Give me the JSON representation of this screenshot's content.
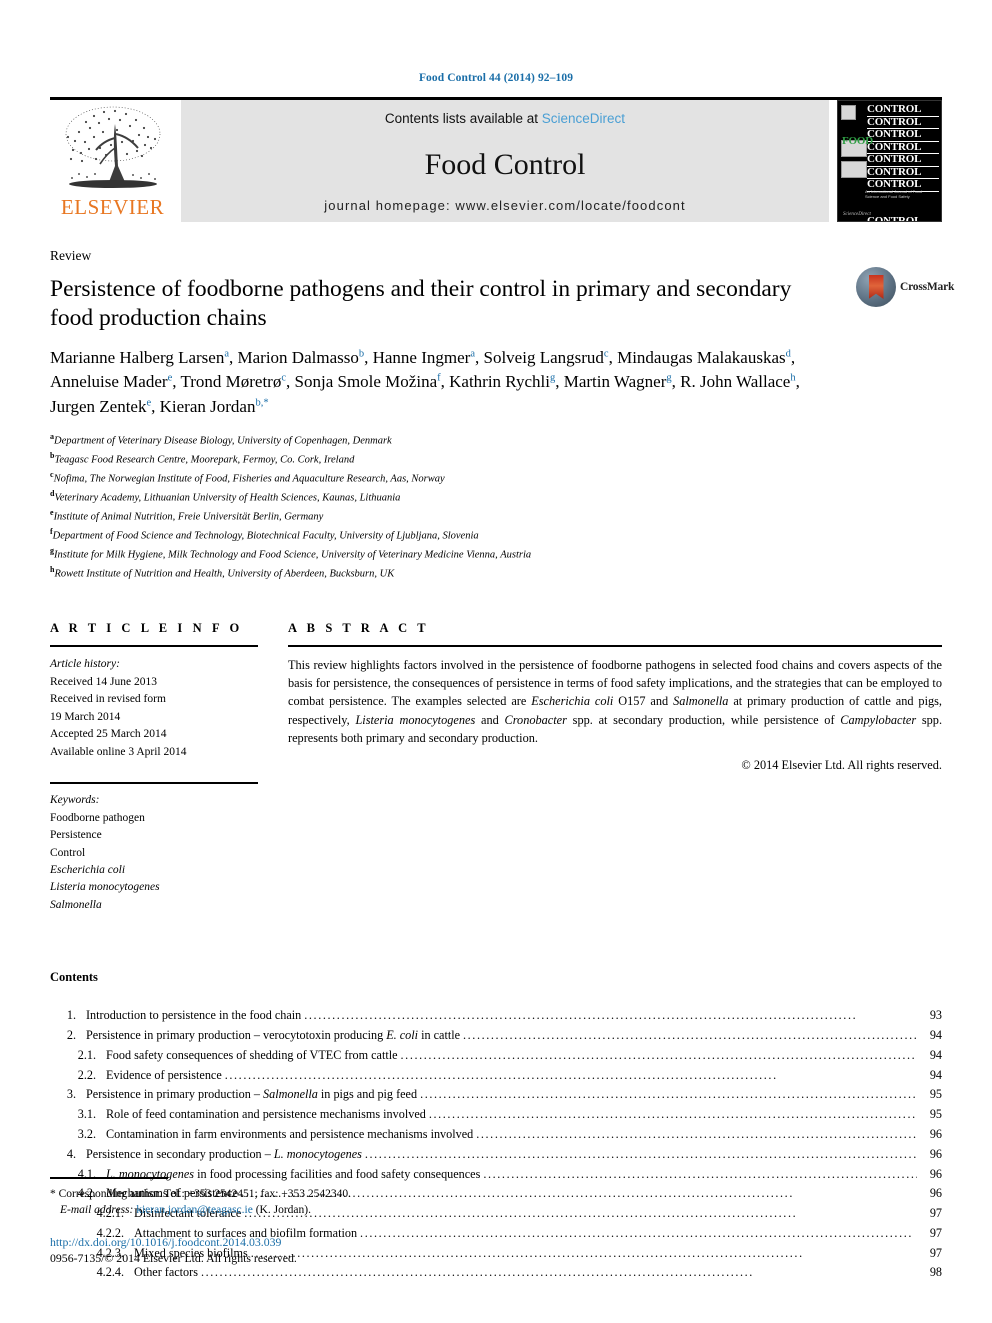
{
  "running_head": "Food Control 44 (2014) 92–109",
  "masthead": {
    "publisher_logo_text": "ELSEVIER",
    "contents_prefix": "Contents lists available at",
    "sciencedirect": "ScienceDirect",
    "journal_title": "Food Control",
    "homepage": "journal homepage: www.elsevier.com/locate/foodcont",
    "cover": {
      "word": "CONTROL",
      "food_word": "FOOD",
      "subtitle": "An International Journal of Food Science and Food Safety",
      "footer": "ScienceDirect"
    }
  },
  "article": {
    "doctype": "Review",
    "title": "Persistence of foodborne pathogens and their control in primary and secondary food production chains",
    "crossmark_label": "CrossMark",
    "authors": [
      {
        "name": "Marianne Halberg Larsen",
        "sup": "a",
        "sep": ", "
      },
      {
        "name": "Marion Dalmasso",
        "sup": "b",
        "sep": ", "
      },
      {
        "name": "Hanne Ingmer",
        "sup": "a",
        "sep": ", "
      },
      {
        "name": "Solveig Langsrud",
        "sup": "c",
        "sep": ", "
      },
      {
        "name": "Mindaugas Malakauskas",
        "sup": "d",
        "sep": ", "
      },
      {
        "name": "Anneluise Mader",
        "sup": "e",
        "sep": ", "
      },
      {
        "name": "Trond Møretrø",
        "sup": "c",
        "sep": ", "
      },
      {
        "name": "Sonja Smole Možina",
        "sup": "f",
        "sep": ", "
      },
      {
        "name": "Kathrin Rychli",
        "sup": "g",
        "sep": ", "
      },
      {
        "name": "Martin Wagner",
        "sup": "g",
        "sep": ", "
      },
      {
        "name": "R. John Wallace",
        "sup": "h",
        "sep": ", "
      },
      {
        "name": "Jurgen Zentek",
        "sup": "e",
        "sep": ", "
      },
      {
        "name": "Kieran Jordan",
        "sup": "b,*",
        "sep": ""
      }
    ],
    "affiliations": [
      {
        "mark": "a",
        "text": "Department of Veterinary Disease Biology, University of Copenhagen, Denmark"
      },
      {
        "mark": "b",
        "text": "Teagasc Food Research Centre, Moorepark, Fermoy, Co. Cork, Ireland"
      },
      {
        "mark": "c",
        "text": "Nofima, The Norwegian Institute of Food, Fisheries and Aquaculture Research, Aas, Norway"
      },
      {
        "mark": "d",
        "text": "Veterinary Academy, Lithuanian University of Health Sciences, Kaunas, Lithuania"
      },
      {
        "mark": "e",
        "text": "Institute of Animal Nutrition, Freie Universität Berlin, Germany"
      },
      {
        "mark": "f",
        "text": "Department of Food Science and Technology, Biotechnical Faculty, University of Ljubljana, Slovenia"
      },
      {
        "mark": "g",
        "text": "Institute for Milk Hygiene, Milk Technology and Food Science, University of Veterinary Medicine Vienna, Austria"
      },
      {
        "mark": "h",
        "text": "Rowett Institute of Nutrition and Health, University of Aberdeen, Bucksburn, UK"
      }
    ]
  },
  "article_info": {
    "heading": "A R T I C L E    I N F O",
    "history_label": "Article history:",
    "history": [
      "Received 14 June 2013",
      "Received in revised form",
      "19 March 2014",
      "Accepted 25 March 2014",
      "Available online 3 April 2014"
    ],
    "keywords_label": "Keywords:",
    "keywords": [
      {
        "text": "Foodborne pathogen",
        "italic": false
      },
      {
        "text": "Persistence",
        "italic": false
      },
      {
        "text": "Control",
        "italic": false
      },
      {
        "text": "Escherichia coli",
        "italic": true
      },
      {
        "text": "Listeria monocytogenes",
        "italic": true
      },
      {
        "text": "Salmonella",
        "italic": true
      }
    ]
  },
  "abstract": {
    "heading": "A B S T R A C T",
    "text": "This review highlights factors involved in the persistence of foodborne pathogens in selected food chains and covers aspects of the basis for persistence, the consequences of persistence in terms of food safety implications, and the strategies that can be employed to combat persistence. The examples selected are Escherichia coli O157 and Salmonella at primary production of cattle and pigs, respectively, Listeria monocytogenes and Cronobacter spp. at secondary production, while persistence of Campylobacter spp. represents both primary and secondary production.",
    "copyright": "© 2014 Elsevier Ltd. All rights reserved."
  },
  "contents": {
    "heading": "Contents",
    "entries": [
      {
        "level": 1,
        "num": "1.",
        "label": "Introduction to persistence in the food chain",
        "page": "93"
      },
      {
        "level": 1,
        "num": "2.",
        "label": "Persistence in primary production – verocytotoxin producing E. coli in cattle",
        "page": "94"
      },
      {
        "level": 2,
        "num": "2.1.",
        "label": "Food safety consequences of shedding of VTEC from cattle",
        "page": "94"
      },
      {
        "level": 2,
        "num": "2.2.",
        "label": "Evidence of persistence",
        "page": "94"
      },
      {
        "level": 1,
        "num": "3.",
        "label": "Persistence in primary production – Salmonella in pigs and pig feed",
        "page": "95"
      },
      {
        "level": 2,
        "num": "3.1.",
        "label": "Role of feed contamination and persistence mechanisms involved",
        "page": "95"
      },
      {
        "level": 2,
        "num": "3.2.",
        "label": "Contamination in farm environments and persistence mechanisms involved",
        "page": "96"
      },
      {
        "level": 1,
        "num": "4.",
        "label": "Persistence in secondary production – L. monocytogenes",
        "page": "96"
      },
      {
        "level": 2,
        "num": "4.1.",
        "label": "L. monocytogenes in food processing facilities and food safety consequences",
        "page": "96"
      },
      {
        "level": 2,
        "num": "4.2.",
        "label": "Mechanisms of persistence",
        "page": "96"
      },
      {
        "level": 3,
        "num": "4.2.1.",
        "label": "Disinfectant tolerance",
        "page": "97"
      },
      {
        "level": 3,
        "num": "4.2.2.",
        "label": "Attachment to surfaces and biofilm formation",
        "page": "97"
      },
      {
        "level": 3,
        "num": "4.2.3.",
        "label": "Mixed species biofilms",
        "page": "97"
      },
      {
        "level": 3,
        "num": "4.2.4.",
        "label": "Other factors",
        "page": "98"
      }
    ]
  },
  "footer": {
    "corresponding": "* Corresponding author. Tel.: +353 2542451; fax: +353 2542340.",
    "email_label": "E-mail address:",
    "email": "kieran.jordan@teagasc.ie",
    "email_suffix": "(K. Jordan).",
    "doi": "http://dx.doi.org/10.1016/j.foodcont.2014.03.039",
    "issn": "0956-7135/© 2014 Elsevier Ltd. All rights reserved."
  },
  "colors": {
    "link_blue": "#1a6ea8",
    "sciencedirect_blue": "#4a9fd4",
    "elsevier_orange": "#E87722",
    "cover_green": "#2f9e44"
  }
}
